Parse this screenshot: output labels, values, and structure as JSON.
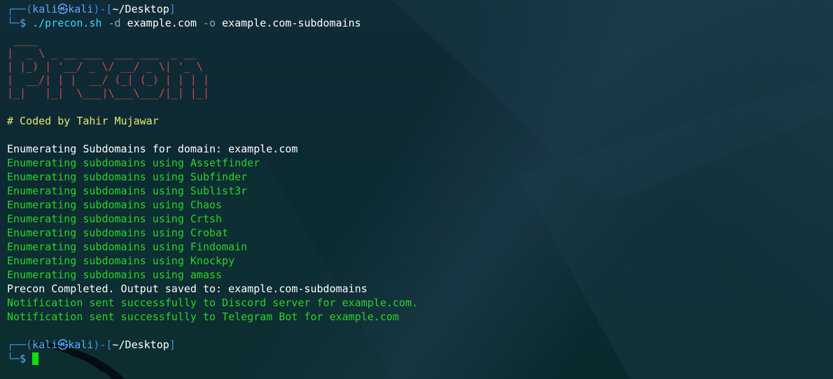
{
  "prompt1": {
    "top_open": "┌──(",
    "user": "kali",
    "at": "㉿",
    "host": "kali",
    "close_dash": ")-[",
    "cwd": "~/Desktop",
    "cwd_close": "]",
    "bottom": "└─",
    "dollar": "$ ",
    "command_prog": "./precon.sh",
    "flag_d": " -d ",
    "arg_d": "example.com",
    "flag_o": " -o ",
    "arg_o": "example.com-subdomains"
  },
  "banner": {
    "line1": " ____",
    "line2": "|  _ \\ _ __ ___  ___ ___  _ __",
    "line3": "| |_) | '__/ _ \\/ __/ _ \\| '_ \\",
    "line4": "|  __/| | |  __/ (_| (_) | | | |",
    "line5": "|_|   |_|  \\___|\\___\\___/|_| |_|"
  },
  "credit": "# Coded by Tahir Mujawar",
  "output": {
    "header": "Enumerating Subdomains for domain: example.com",
    "steps": [
      "Enumerating subdomains using Assetfinder",
      "Enumerating subdomains using Subfinder",
      "Enumerating subdomains using Sublist3r",
      "Enumerating subdomains using Chaos",
      "Enumerating subdomains using Crtsh",
      "Enumerating subdomains using Crobat",
      "Enumerating subdomains using Findomain",
      "Enumerating subdomains using Knockpy",
      "Enumerating subdomains using amass"
    ],
    "completed": "Precon Completed. Output saved to: example.com-subdomains",
    "notify_discord": "Notification sent successfully to Discord server for example.com.",
    "notify_telegram": "Notification sent successfully to Telegram Bot for example.com"
  },
  "prompt2": {
    "top_open": "┌──(",
    "user": "kali",
    "at": "㉿",
    "host": "kali",
    "close_dash": ")-[",
    "cwd": "~/Desktop",
    "cwd_close": "]",
    "bottom": "└─",
    "dollar": "$ "
  },
  "colors": {
    "background": "#0d2a33",
    "prompt_blue": "#3b8eea",
    "success_green": "#29d329",
    "banner_red": "#d04848",
    "credit_yellow": "#e7e76b",
    "cursor_green": "#0fdc0f"
  }
}
